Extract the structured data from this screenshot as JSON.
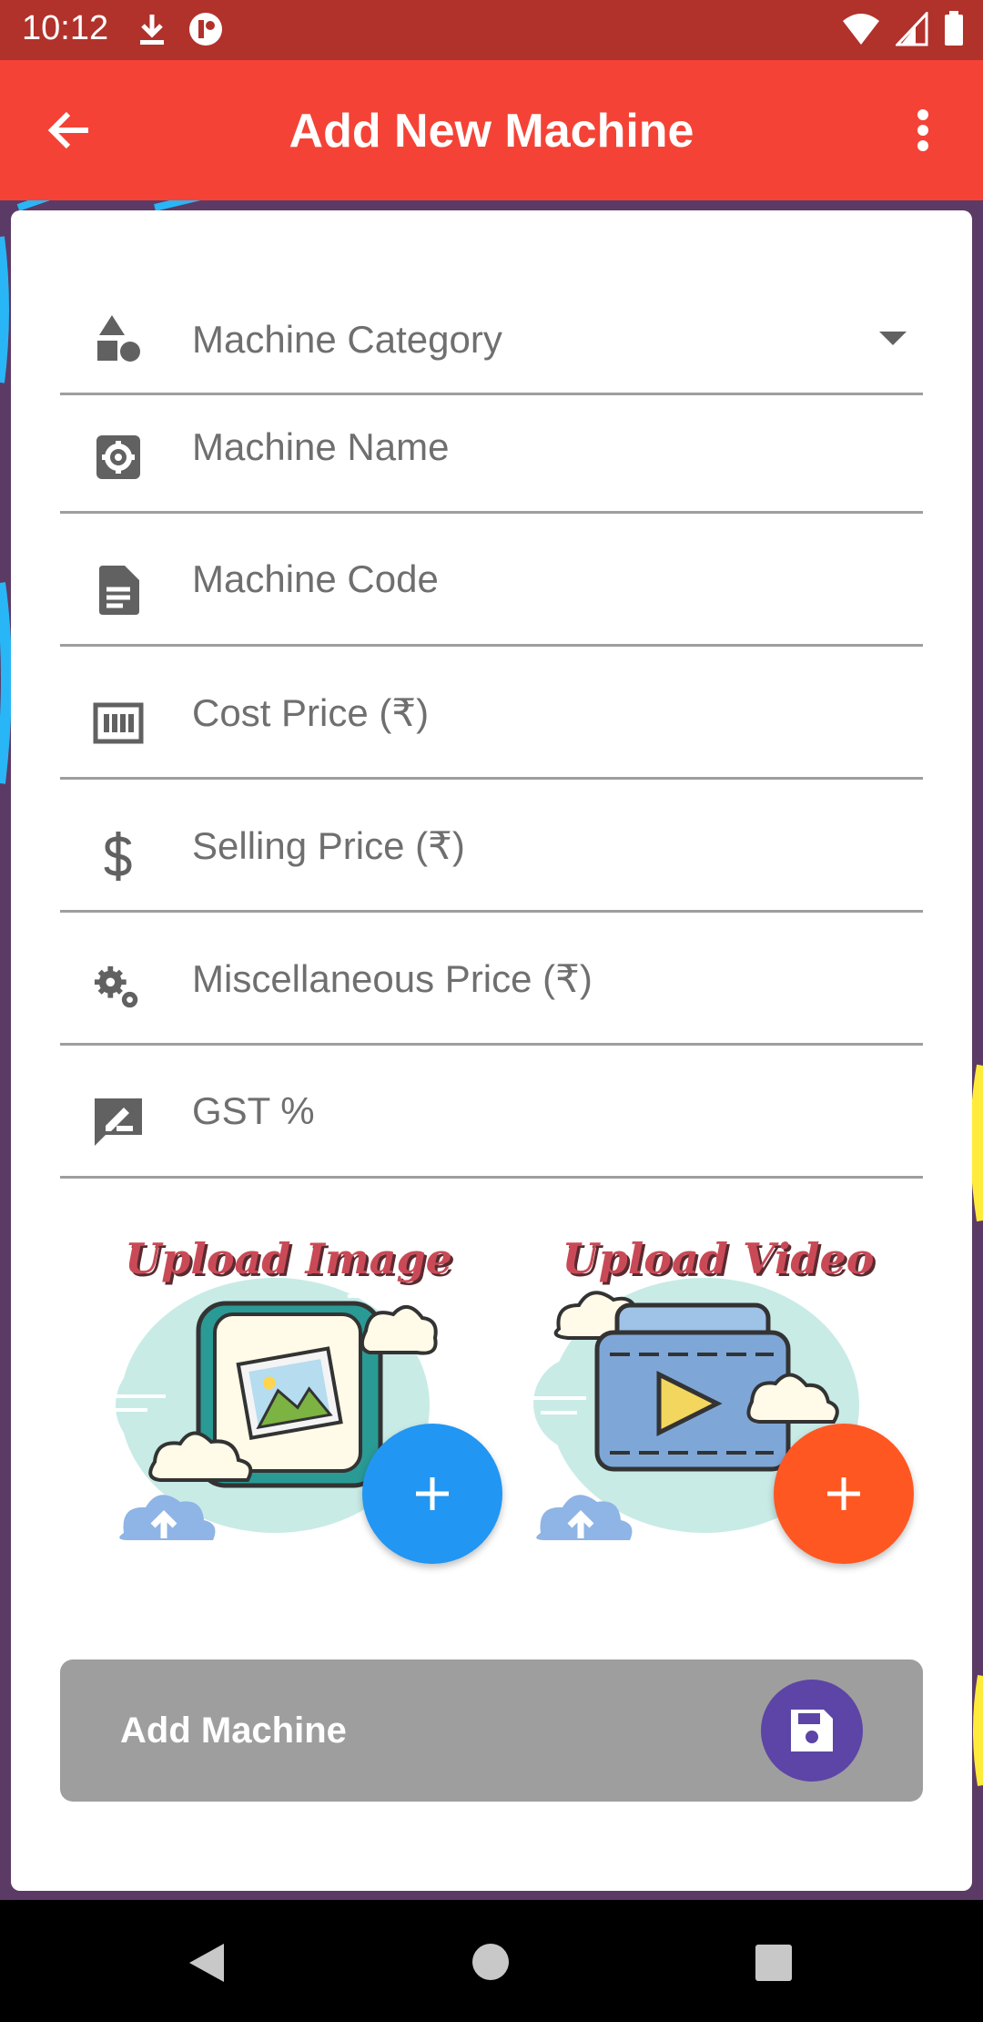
{
  "status_bar": {
    "time": "10:12",
    "icons_left": [
      "download-icon",
      "app-notification-icon"
    ],
    "icons_right": [
      "wifi-icon",
      "signal-icon",
      "battery-icon"
    ]
  },
  "app_bar": {
    "title": "Add New Machine",
    "back_icon": "arrow-left-icon",
    "menu_icon": "more-vert-icon",
    "color": "#f44336"
  },
  "form": {
    "fields": [
      {
        "label": "Machine Category",
        "icon": "shapes-icon",
        "type": "dropdown"
      },
      {
        "label": "Machine Name",
        "icon": "settings-box-icon",
        "type": "text"
      },
      {
        "label": "Machine Code",
        "icon": "document-icon",
        "type": "text"
      },
      {
        "label": "Cost Price (₹)",
        "icon": "barcode-price-icon",
        "type": "number"
      },
      {
        "label": "Selling Price (₹)",
        "icon": "dollar-icon",
        "type": "number"
      },
      {
        "label": "Miscellaneous Price (₹)",
        "icon": "gears-icon",
        "type": "number"
      },
      {
        "label": "GST %",
        "icon": "rate-review-icon",
        "type": "number"
      }
    ]
  },
  "uploads": {
    "image": {
      "title": "Upload Image",
      "fab_color": "#2196f3"
    },
    "video": {
      "title": "Upload Video",
      "fab_color": "#ff5722"
    }
  },
  "submit": {
    "label": "Add Machine",
    "icon": "save-icon",
    "color": "#9e9e9e",
    "icon_bg": "#5c45a6"
  },
  "nav_bar": {
    "icons": [
      "back-triangle-icon",
      "home-circle-icon",
      "recents-square-icon"
    ]
  }
}
